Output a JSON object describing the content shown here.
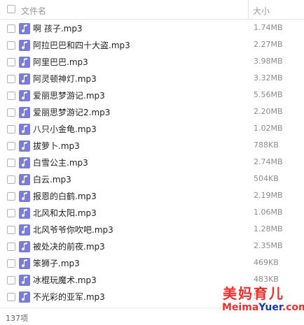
{
  "header": {
    "name_col": "文件名",
    "size_col": "大小"
  },
  "files": [
    {
      "name": "啊 孩子.mp3",
      "size": "1.74MB"
    },
    {
      "name": "阿拉巴巴和四十大盗.mp3",
      "size": "2.27MB"
    },
    {
      "name": "阿里巴巴.mp3",
      "size": "3.98MB"
    },
    {
      "name": "阿灵顿神灯.mp3",
      "size": "3.32MB"
    },
    {
      "name": "爱丽思梦游记.mp3",
      "size": "5.56MB"
    },
    {
      "name": "爱丽思梦游记2.mp3",
      "size": "2.20MB"
    },
    {
      "name": "八只小金龟.mp3",
      "size": "1.02MB"
    },
    {
      "name": "拔萝卜.mp3",
      "size": "788KB"
    },
    {
      "name": "白雪公主.mp3",
      "size": "2.74MB"
    },
    {
      "name": "白云.mp3",
      "size": "504KB"
    },
    {
      "name": "报恩的白鹤.mp3",
      "size": "2.19MB"
    },
    {
      "name": "北风和太阳.mp3",
      "size": "1.06MB"
    },
    {
      "name": "北风爷爷你吹吧.mp3",
      "size": "1.28MB"
    },
    {
      "name": "被处决的前夜.mp3",
      "size": "2.35MB"
    },
    {
      "name": "笨狮子.mp3",
      "size": "469KB"
    },
    {
      "name": "冰棍玩魔术.mp3",
      "size": "483KB"
    },
    {
      "name": "不光彩的亚军.mp3",
      "size": "5"
    }
  ],
  "footer": {
    "count": "137项"
  },
  "watermark": {
    "line1": "美妈育儿",
    "line2a": "Meima",
    "line2b": "Yuer",
    "line2c": ".com"
  },
  "colors": {
    "file_icon": "#7a7cd9",
    "watermark_red": "#ee2e2e",
    "watermark_blue": "#1a3aa8"
  },
  "icons": {
    "file": "music-note-icon"
  }
}
